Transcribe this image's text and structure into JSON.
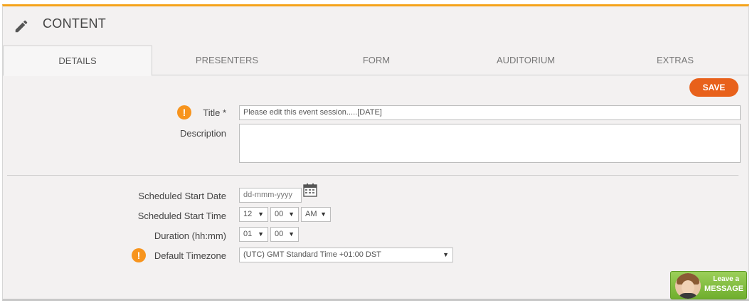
{
  "header": {
    "title": "CONTENT",
    "icon": "pencil-icon"
  },
  "tabs": [
    {
      "label": "DETAILS",
      "active": true
    },
    {
      "label": "PRESENTERS",
      "active": false
    },
    {
      "label": "FORM",
      "active": false
    },
    {
      "label": "AUDITORIUM",
      "active": false
    },
    {
      "label": "EXTRAS",
      "active": false
    }
  ],
  "toolbar": {
    "save_label": "SAVE"
  },
  "form": {
    "title_label": "Title *",
    "title_value": "Please edit this event session.....[DATE]",
    "description_label": "Description",
    "description_value": "",
    "start_date_label": "Scheduled Start Date",
    "start_date_placeholder": "dd-mmm-yyyy",
    "start_time_label": "Scheduled Start Time",
    "start_hour": "12",
    "start_minute": "00",
    "start_ampm": "AM",
    "duration_label": "Duration (hh:mm)",
    "duration_hours": "01",
    "duration_minutes": "00",
    "timezone_label": "Default Timezone",
    "timezone_value": "(UTC) GMT Standard Time +01:00 DST",
    "warning_glyph": "!"
  },
  "chat_widget": {
    "line1": "Leave a",
    "line2": "MESSAGE"
  },
  "colors": {
    "accent": "#f5a31a",
    "save": "#e8611b",
    "warning": "#f7941d",
    "chat": "#7bb83a"
  }
}
